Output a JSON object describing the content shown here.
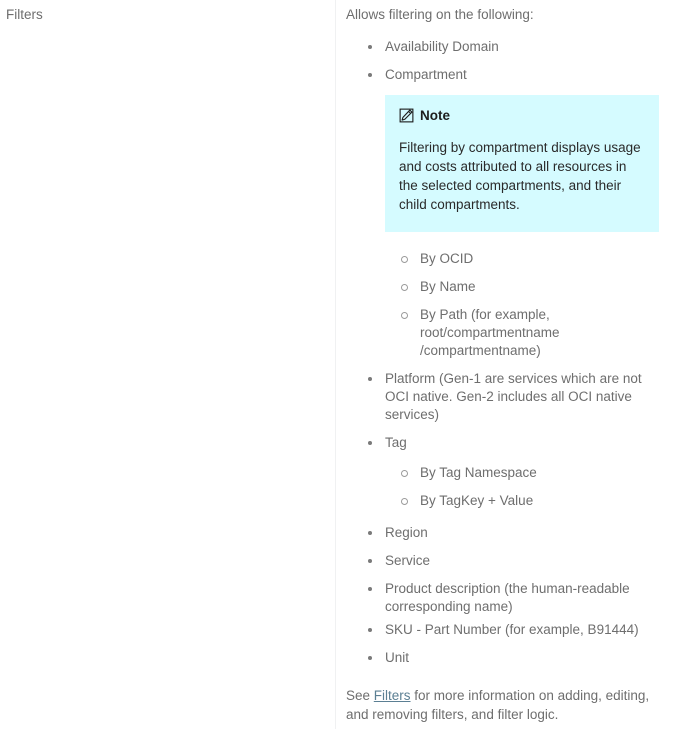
{
  "row": {
    "label": "Filters",
    "intro": "Allows filtering on the following:",
    "note": {
      "icon": "note-edit-icon",
      "title": "Note",
      "body": "Filtering by compartment displays usage and costs attributed to all resources in the selected compartments, and their child compartments.",
      "background_color": "#d5fbff"
    },
    "bullets": {
      "availability_domain": "Availability Domain",
      "compartment": "Compartment",
      "compartment_sub": {
        "by_ocid": "By OCID",
        "by_name": "By Name",
        "by_path_line1": "By Path (for example,",
        "by_path_line2": "root/compartmentname",
        "by_path_line3": "/compartmentname)"
      },
      "platform": "Platform (Gen-1 are services which are not OCI native. Gen-2 includes all OCI native services)",
      "tag": "Tag",
      "tag_sub": {
        "by_tag_namespace": "By Tag Namespace",
        "by_tagkey_value": "By TagKey + Value"
      },
      "region": "Region",
      "service": "Service",
      "product_description": "Product description (the human-readable corresponding name)",
      "sku": "SKU - Part Number (for example, B91444)",
      "unit": "Unit"
    },
    "closing": {
      "before_link": "See ",
      "link_text": "Filters",
      "after_link": " for more information on adding, editing, and removing filters, and filter logic.",
      "link_color": "#5b7f93"
    }
  }
}
